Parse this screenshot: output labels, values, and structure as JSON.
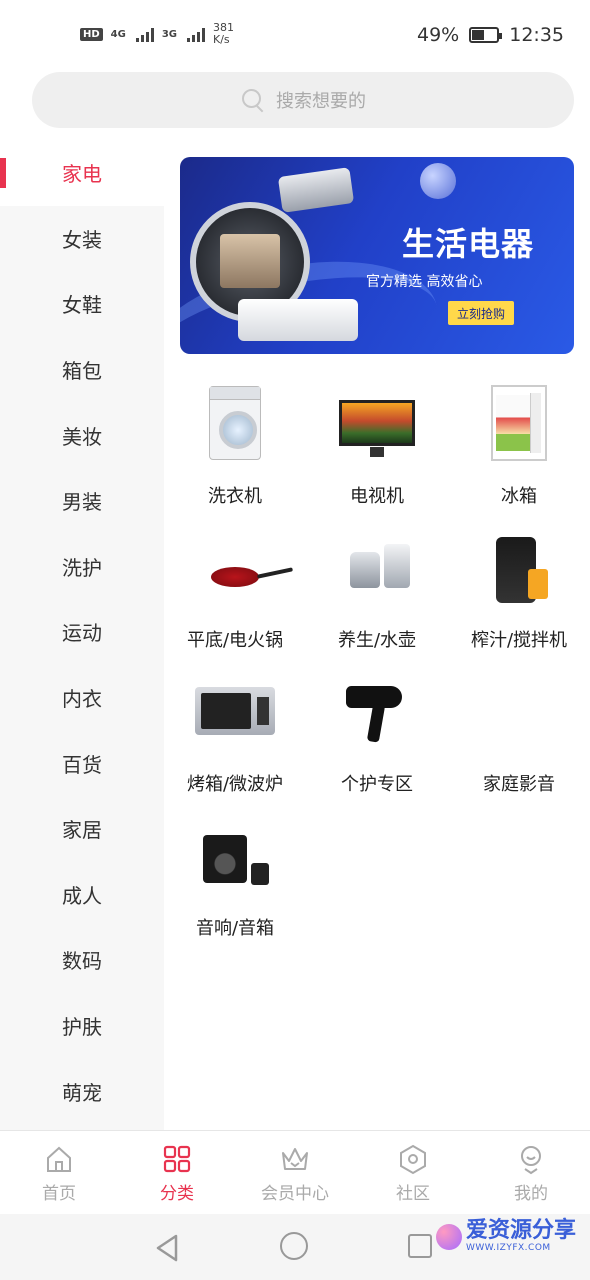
{
  "status_bar": {
    "hd": "HD",
    "net1": "4G",
    "net2": "3G",
    "speed_value": "381",
    "speed_unit": "K/s",
    "battery": "49%",
    "battery_level": 0.49,
    "time": "12:35"
  },
  "search": {
    "placeholder": "搜索想要的",
    "icon": "search-icon"
  },
  "sidebar": {
    "items": [
      {
        "label": "家电",
        "active": true
      },
      {
        "label": "女装",
        "active": false
      },
      {
        "label": "女鞋",
        "active": false
      },
      {
        "label": "箱包",
        "active": false
      },
      {
        "label": "美妆",
        "active": false
      },
      {
        "label": "男装",
        "active": false
      },
      {
        "label": "洗护",
        "active": false
      },
      {
        "label": "运动",
        "active": false
      },
      {
        "label": "内衣",
        "active": false
      },
      {
        "label": "百货",
        "active": false
      },
      {
        "label": "家居",
        "active": false
      },
      {
        "label": "成人",
        "active": false
      },
      {
        "label": "数码",
        "active": false
      },
      {
        "label": "护肤",
        "active": false
      },
      {
        "label": "萌宠",
        "active": false
      }
    ]
  },
  "banner": {
    "title": "生活电器",
    "subtitle": "官方精选 高效省心",
    "button": "立刻抢购"
  },
  "categories": [
    {
      "label": "洗衣机",
      "icon": "washing-machine"
    },
    {
      "label": "电视机",
      "icon": "television"
    },
    {
      "label": "冰箱",
      "icon": "refrigerator"
    },
    {
      "label": "平底/电火锅",
      "icon": "frying-pan"
    },
    {
      "label": "养生/水壶",
      "icon": "kettle"
    },
    {
      "label": "榨汁/搅拌机",
      "icon": "juicer"
    },
    {
      "label": "烤箱/微波炉",
      "icon": "microwave"
    },
    {
      "label": "个护专区",
      "icon": "hair-dryer"
    },
    {
      "label": "家庭影音",
      "icon": "home-theater"
    },
    {
      "label": "音响/音箱",
      "icon": "speaker"
    }
  ],
  "tabbar": {
    "items": [
      {
        "label": "首页",
        "icon": "home-icon",
        "active": false
      },
      {
        "label": "分类",
        "icon": "grid-icon",
        "active": true
      },
      {
        "label": "会员中心",
        "icon": "crown-icon",
        "active": false
      },
      {
        "label": "社区",
        "icon": "hexagon-icon",
        "active": false
      },
      {
        "label": "我的",
        "icon": "person-icon",
        "active": false
      }
    ]
  },
  "watermark": {
    "cn": "爱资源分享",
    "en": "WWW.IZYFX.COM"
  },
  "colors": {
    "accent": "#e8334f",
    "banner_blue": "#2140c8",
    "sidebar_bg": "#f7f7f7"
  }
}
